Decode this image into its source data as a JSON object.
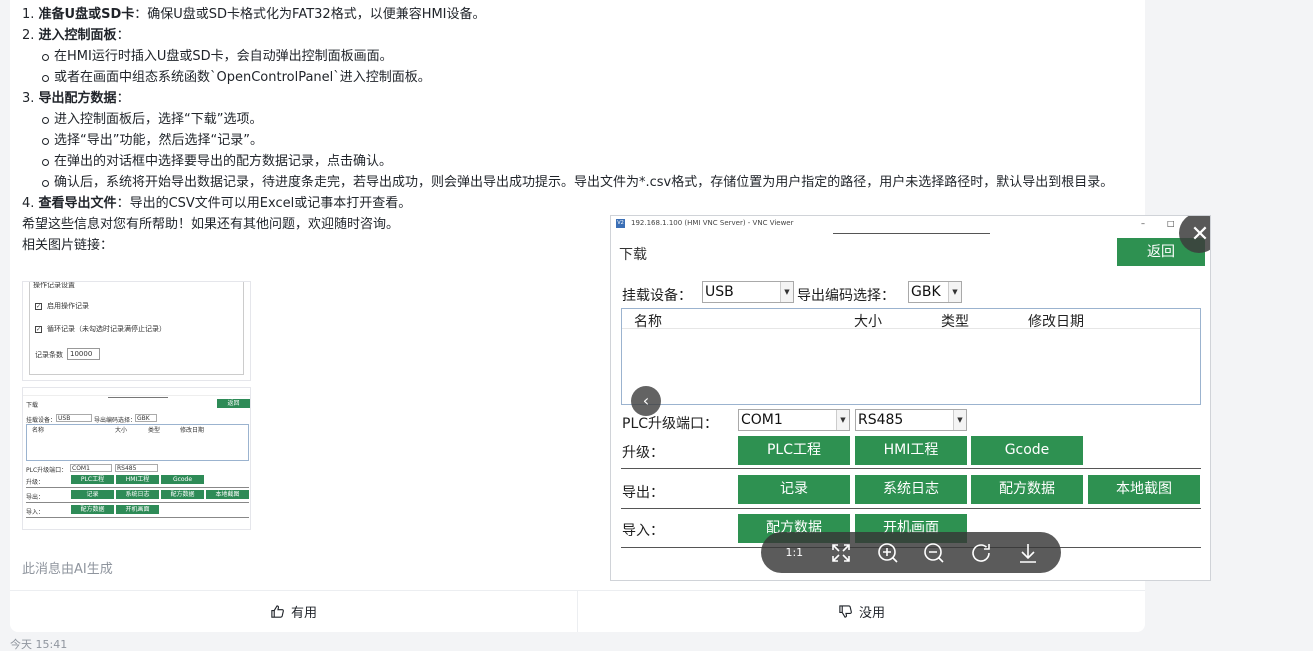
{
  "message": {
    "steps": [
      {
        "num": "1.",
        "title": "准备U盘或SD卡",
        "text": "：确保U盘或SD卡格式化为FAT32格式，以便兼容HMI设备。",
        "bullets": []
      },
      {
        "num": "2.",
        "title": "进入控制面板",
        "text": "：",
        "bullets": [
          "在HMI运行时插入U盘或SD卡，会自动弹出控制面板画面。",
          "或者在画面中组态系统函数`OpenControlPanel`进入控制面板。"
        ]
      },
      {
        "num": "3.",
        "title": "导出配方数据",
        "text": "：",
        "bullets": [
          "进入控制面板后，选择“下载”选项。",
          "选择“导出”功能，然后选择“记录”。",
          "在弹出的对话框中选择要导出的配方数据记录，点击确认。",
          "确认后，系统将开始导出数据记录，待进度条走完，若导出成功，则会弹出导出成功提示。导出文件为*.csv格式，存储位置为用户指定的路径，用户未选择路径时，默认导出到根目录。"
        ]
      },
      {
        "num": "4.",
        "title": "查看导出文件",
        "text": "：导出的CSV文件可以用Excel或记事本打开查看。",
        "bullets": []
      }
    ],
    "closing": "希望这些信息对您有所帮助！如果还有其他问题，欢迎随时咨询。",
    "images_label": "相关图片链接：",
    "ai_note": "此消息由AI生成"
  },
  "thumb1": {
    "group_title": "操作记录设置",
    "enable_log": "启用操作记录",
    "cyclic_log": "循环记录（未勾选时记录满停止记录）",
    "count_label": "记录条数",
    "count_value": "10000"
  },
  "thumb2": {
    "title": "下载",
    "back": "返回",
    "mount": "挂载设备：",
    "mount_val": "USB",
    "enc": "导出编码选择：",
    "enc_val": "GBK",
    "cols": [
      "名称",
      "大小",
      "类型",
      "修改日期"
    ],
    "port": "PLC升级端口：",
    "port_val": "COM1",
    "proto_val": "RS485",
    "upgrade": "升级：",
    "export": "导出：",
    "import": "导入：",
    "b_plc": "PLC工程",
    "b_hmi": "HMI工程",
    "b_gcode": "Gcode",
    "b_rec": "记录",
    "b_syslog": "系统日志",
    "b_recipe": "配方数据",
    "b_shot": "本地截图",
    "b_recipe2": "配方数据",
    "b_boot": "开机画面"
  },
  "viewer": {
    "window_title": "192.168.1.100 (HMI VNC Server) - VNC Viewer",
    "app_icon": "V2",
    "min": "–",
    "max": "□",
    "page_title": "下载",
    "back": "返回",
    "mount_label": "挂载设备：",
    "mount_value": "USB",
    "enc_label": "导出编码选择：",
    "enc_value": "GBK",
    "col_name": "名称",
    "col_size": "大小",
    "col_type": "类型",
    "col_date": "修改日期",
    "port_label": "PLC升级端口：",
    "port_value": "COM1",
    "proto_value": "RS485",
    "upgrade_label": "升级：",
    "btn_plc": "PLC工程",
    "btn_hmi": "HMI工程",
    "btn_gcode": "Gcode",
    "export_label": "导出：",
    "btn_record": "记录",
    "btn_syslog": "系统日志",
    "btn_recipe": "配方数据",
    "btn_screenshot": "本地截图",
    "import_label": "导入：",
    "btn_import_recipe": "配方数据",
    "btn_boot_screen": "开机画面",
    "actual_size": "1:1",
    "close_glyph": "✕",
    "prev_glyph": "‹"
  },
  "feedback": {
    "useful": "有用",
    "useless": "没用"
  },
  "timestamp": "今天 15:41",
  "colors": {
    "hmi_green": "#2e9151",
    "page_bg": "#f3f4f6"
  }
}
